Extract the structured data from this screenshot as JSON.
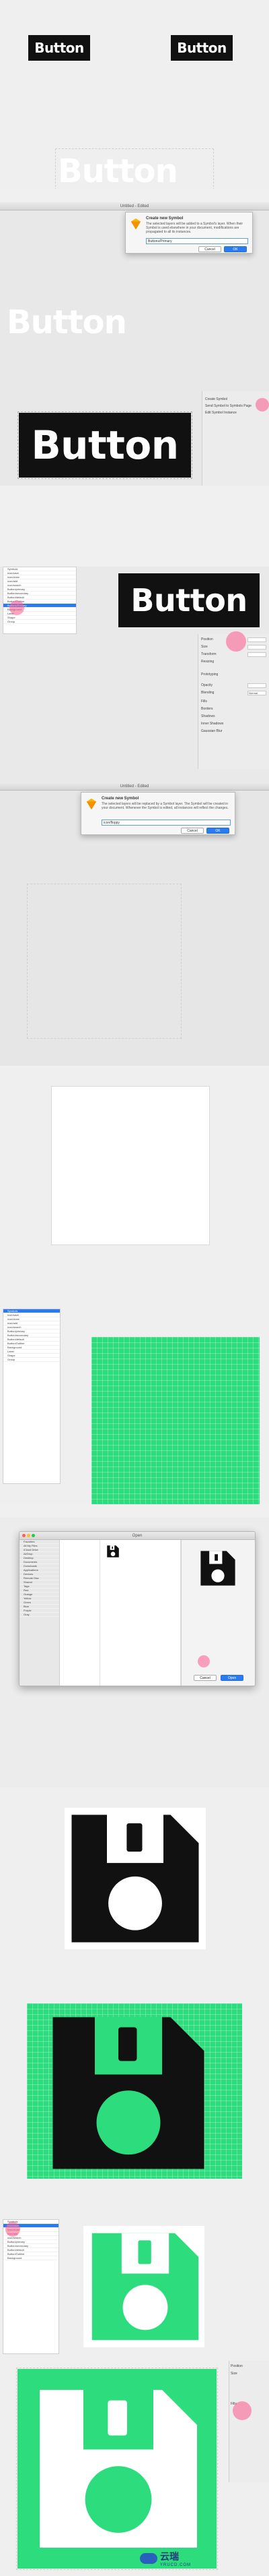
{
  "panel1": {
    "button_small_left": "Button",
    "button_small_right": "Button",
    "ghost_button": "Button"
  },
  "panel2": {
    "window_title": "Untitled - Edited",
    "dialog_title": "Create new Symbol",
    "dialog_body": "The selected layers will be added to a Symbol's layer. When their Symbol is used elsewhere in your document, modifications are propagated to all its instances.",
    "dialog_input": "Buttons/Primary",
    "cancel_label": "Cancel",
    "ok_label": "OK",
    "ghost_button": "Button",
    "big_button": "Button",
    "right_button": "Button",
    "inspector_rows": [
      "Position",
      "Size",
      "Transform",
      "Resizing",
      "Prototyping",
      "Opacity",
      "Blending",
      "Fills",
      "Borders",
      "Shadows",
      "Inner Shadows",
      "Gaussian Blur"
    ],
    "layer_items": [
      "Symbols",
      "icon/save",
      "icon/close",
      "icon/add",
      "icon/search",
      "Button/primary",
      "Button/secondary",
      "Button/default",
      "Button/Outline",
      "Buttons/Primary",
      "Background",
      "Label",
      "Shape",
      "Group"
    ],
    "selected_layer_index": 9,
    "blend_value": "Normal",
    "symbol_option_labels": [
      "Create Symbol",
      "Send Symbol to Symbols Page",
      "Edit Symbol Instance"
    ]
  },
  "panel3": {
    "window_title": "Untitled - Edited",
    "dialog_title": "Create new Symbol",
    "dialog_body": "The selected layers will be replaced by a Symbol layer. The Symbol will be created in your document. Whenever the Symbol is edited, all instances will reflect the changes.",
    "dialog_input": "icon/floppy",
    "cancel_label": "Cancel",
    "ok_label": "OK"
  },
  "panel5": {
    "window_title": "Open",
    "sidebar_items": [
      "Favorites",
      "All My Files",
      "iCloud Drive",
      "AirDrop",
      "Desktop",
      "Documents",
      "Downloads",
      "Applications",
      "Devices",
      "Remote Disc",
      "Shared",
      "Tags",
      "Red",
      "Orange",
      "Yellow",
      "Green",
      "Blue",
      "Purple",
      "Gray"
    ],
    "cancel_label": "Cancel",
    "open_label": "Open"
  },
  "watermark": {
    "brand": "云瑞",
    "site": "YRUCD.COM"
  },
  "colors": {
    "green": "#2ddc7d",
    "black": "#111111",
    "accent": "#2a7bf2",
    "highlight": "#ff5a8c"
  }
}
